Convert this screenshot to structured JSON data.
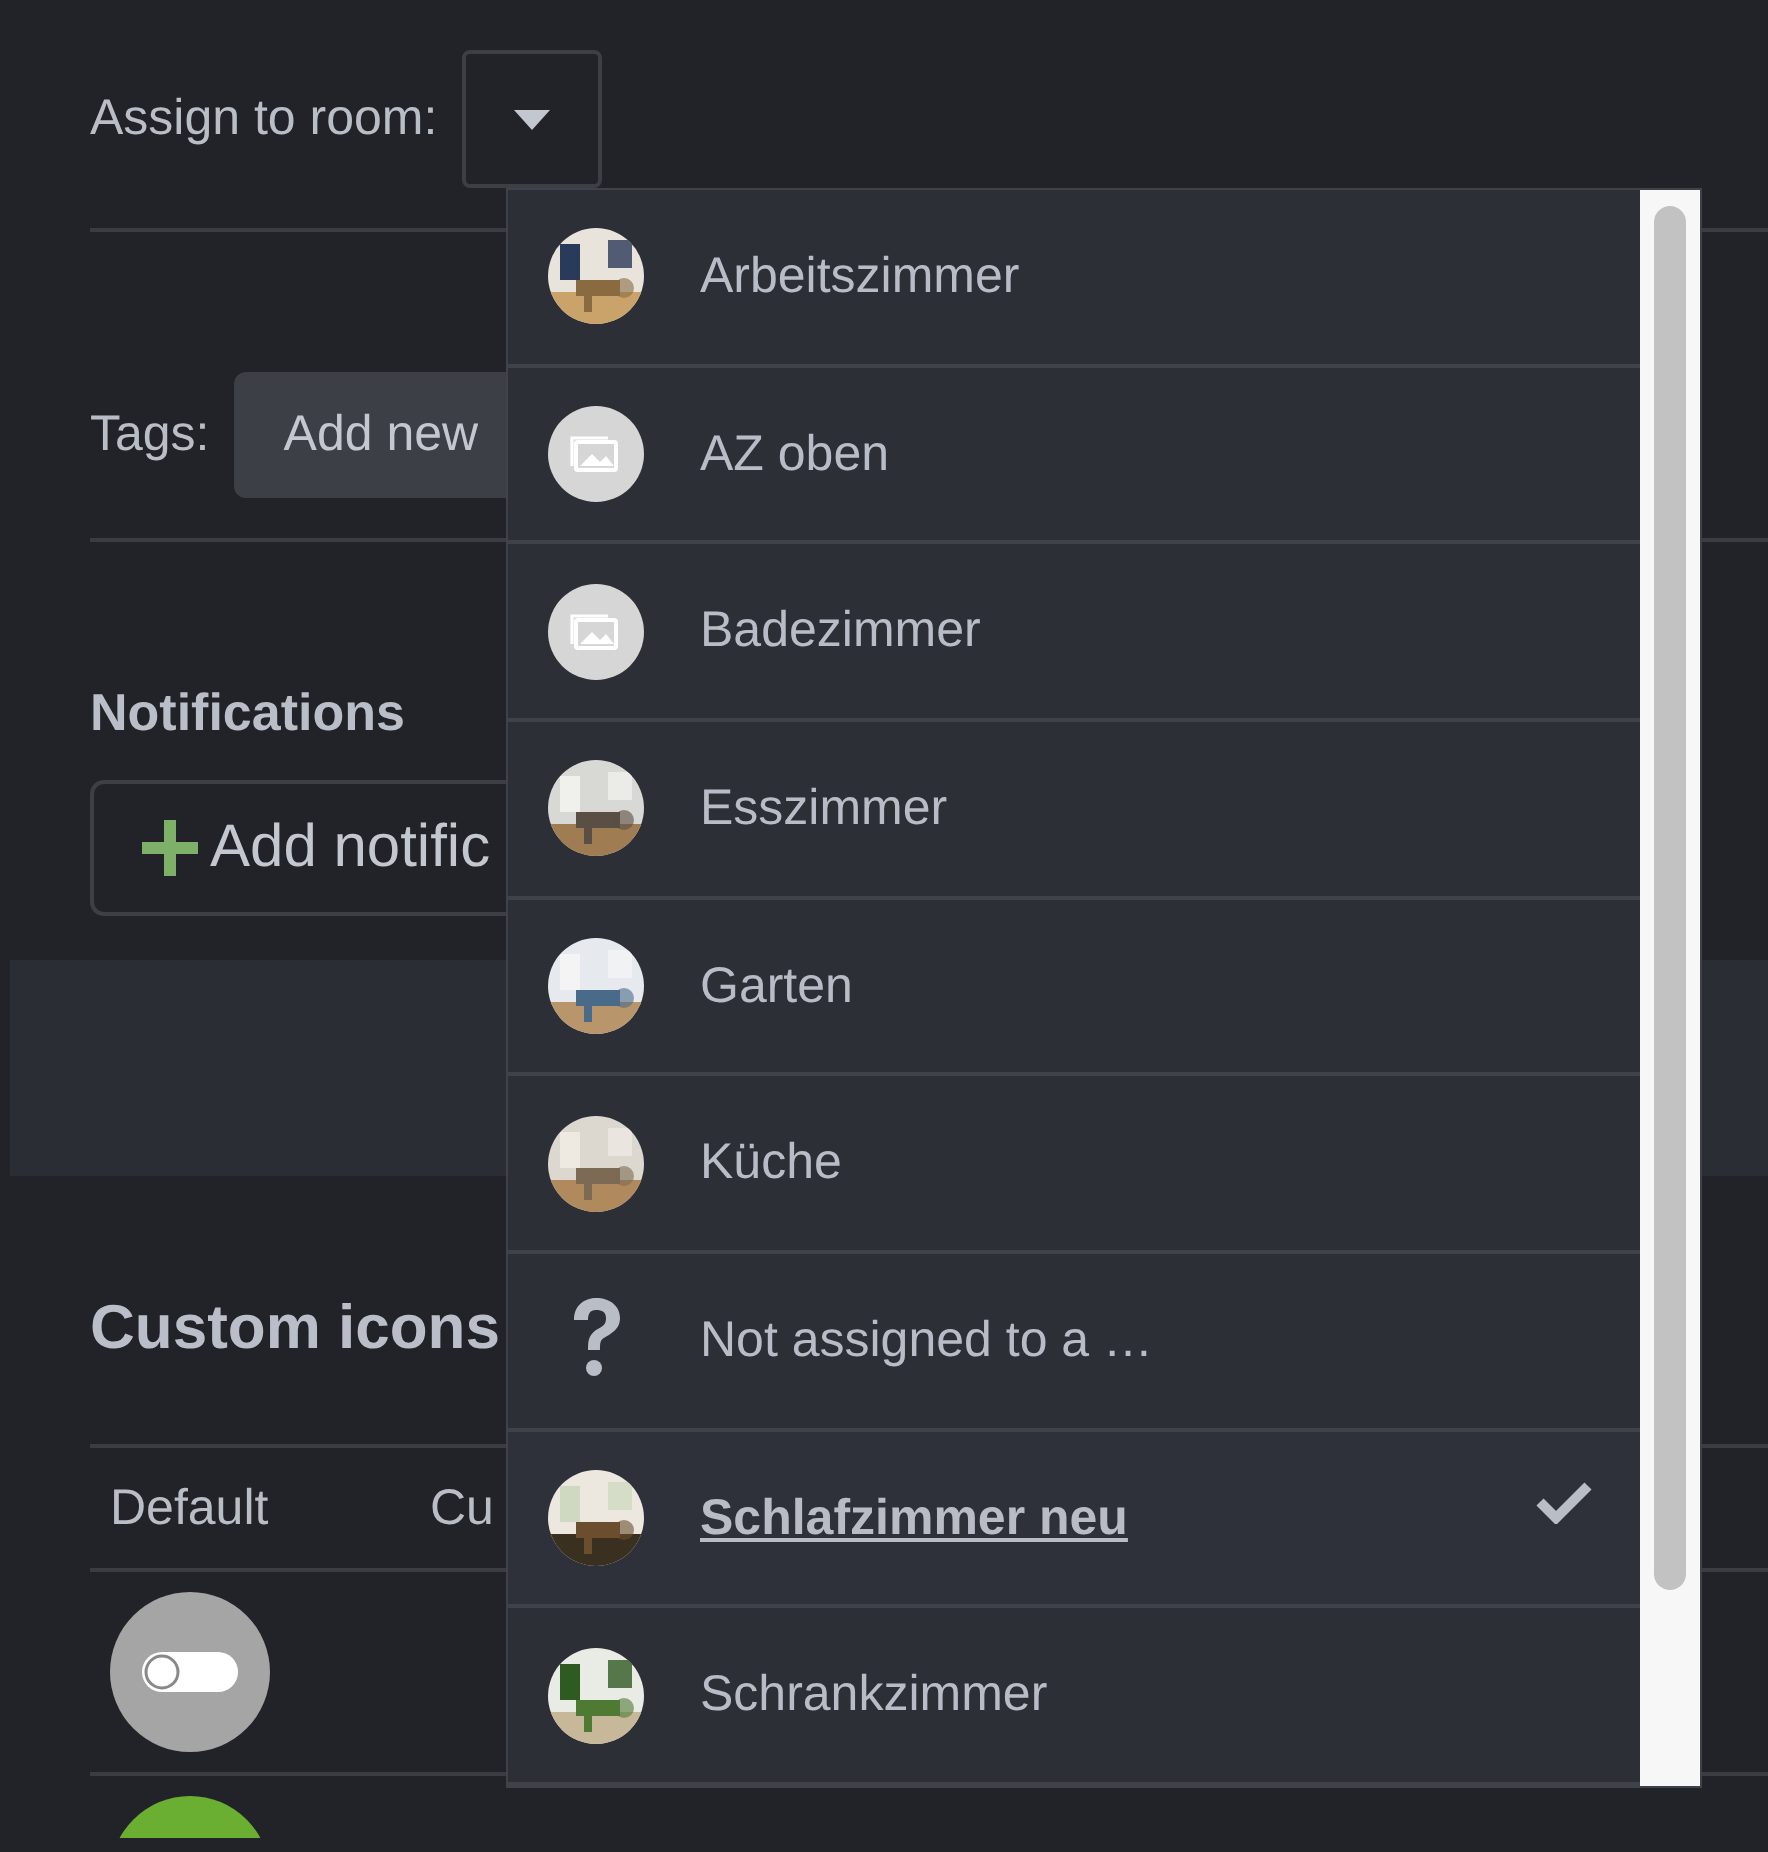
{
  "assign_room": {
    "label": "Assign to room:",
    "expanded": true
  },
  "tags": {
    "label": "Tags:",
    "button": "Add new"
  },
  "notifications": {
    "title": "Notifications",
    "button": "Add notific"
  },
  "custom_icons": {
    "title": "Custom icons",
    "columns": [
      "Default",
      "Cu"
    ]
  },
  "room_menu": [
    {
      "label": "Arbeitszimmer",
      "selected": false
    },
    {
      "label": "AZ oben",
      "kind": "placeholder",
      "selected": false
    },
    {
      "label": "Badezimmer",
      "kind": "placeholder",
      "selected": false
    },
    {
      "label": "Esszimmer",
      "selected": false
    },
    {
      "label": "Garten",
      "selected": false
    },
    {
      "label": "Küche",
      "selected": false
    },
    {
      "label": "Not assigned to a …",
      "kind": "none",
      "selected": false
    },
    {
      "label": "Schlafzimmer neu",
      "selected": true
    },
    {
      "label": "Schrankzimmer",
      "selected": false
    }
  ]
}
